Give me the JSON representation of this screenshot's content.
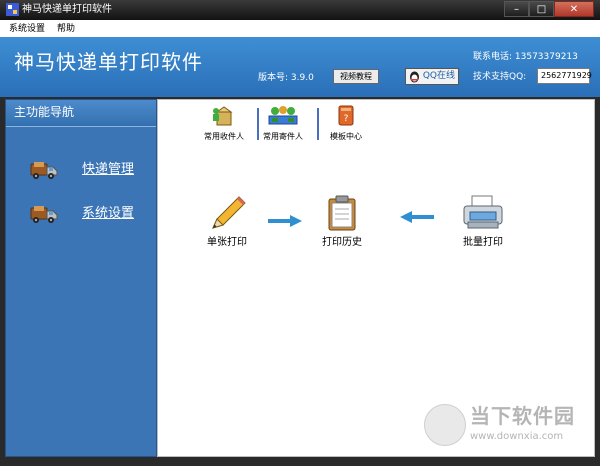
{
  "window": {
    "title": "神马快递单打印软件"
  },
  "menu": {
    "items": [
      "系统设置",
      "帮助"
    ]
  },
  "header": {
    "app_title": "神马快递单打印软件",
    "version": "版本号: 3.9.0",
    "video_button": "视频教程",
    "qq_online": "QQ在线",
    "phone": "联系电话: 13573379213",
    "qq_support_label": "技术支持QQ:",
    "qq_number": "2562771929"
  },
  "sidebar": {
    "title": "主功能导航",
    "items": [
      {
        "label": "快递管理",
        "icon": "truck-icon"
      },
      {
        "label": "系统设置",
        "icon": "truck-icon"
      }
    ]
  },
  "quick_actions": [
    {
      "label": "常用收件人",
      "icon": "recipient-icon"
    },
    {
      "label": "常用寄件人",
      "icon": "sender-icon"
    },
    {
      "label": "模板中心",
      "icon": "template-book-icon"
    }
  ],
  "flow": {
    "single_print": "单张打印",
    "print_history": "打印历史",
    "batch_print": "批量打印"
  },
  "watermark": {
    "text": "当下软件园",
    "url": "www.downxia.com"
  },
  "colors": {
    "header": "#2f7bc7",
    "sidebar": "#3b75b6",
    "title_bar": "#1e1e1e",
    "arrow": "#2f8fd0"
  }
}
